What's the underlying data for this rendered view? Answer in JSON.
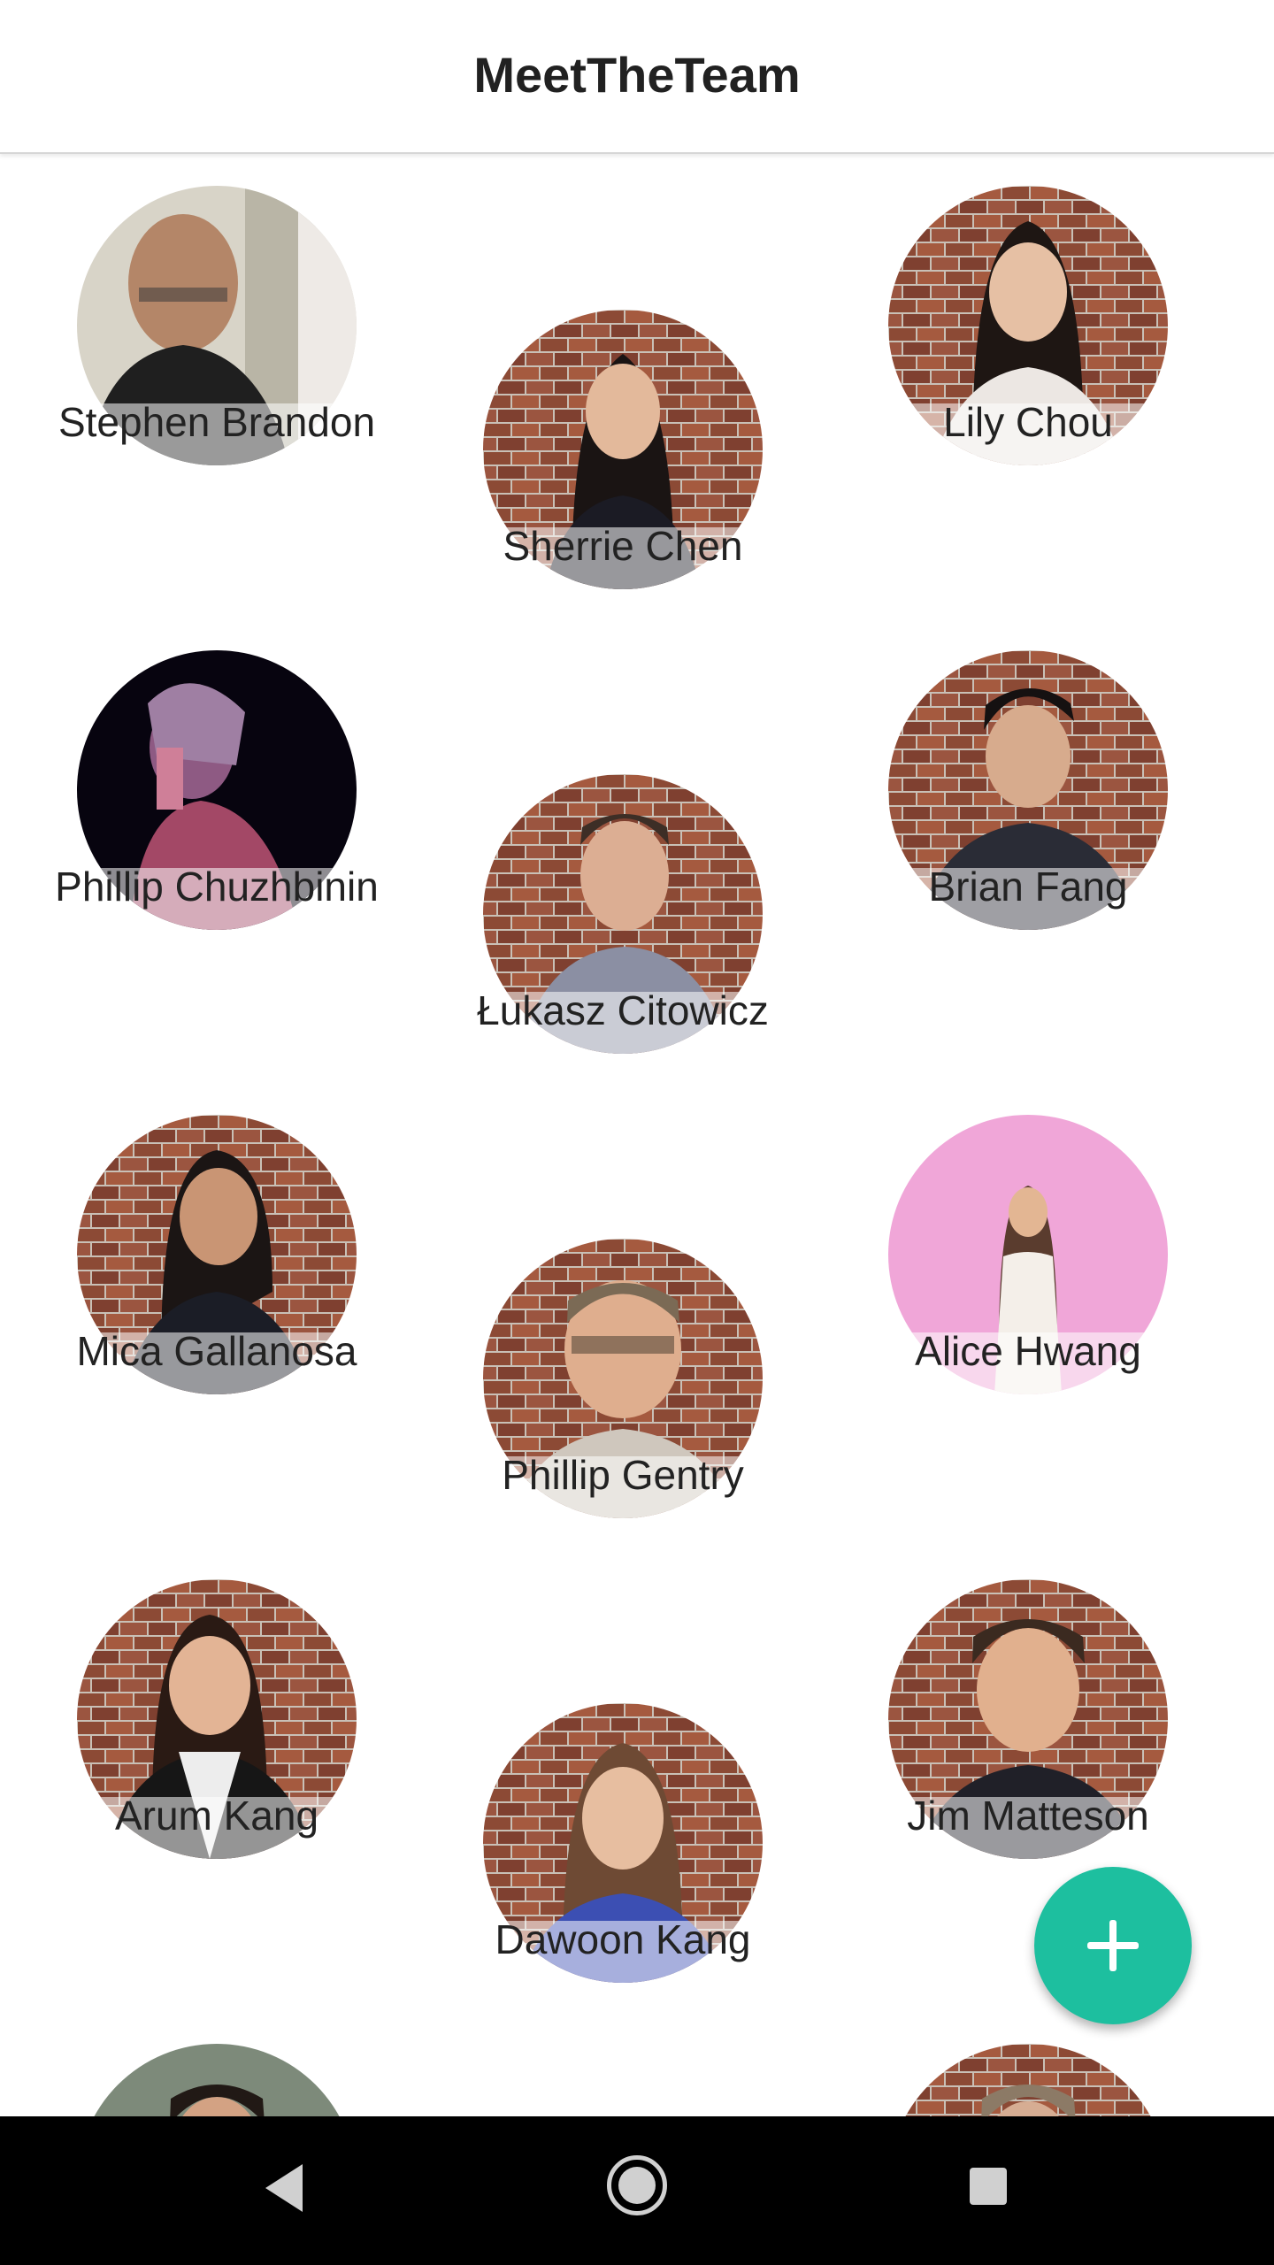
{
  "app": {
    "title": "MeetTheTeam"
  },
  "colors": {
    "accent": "#1dbf9f",
    "app_bar_background": "#ffffff",
    "nav_bar_background": "#000000"
  },
  "team": {
    "members": [
      {
        "name": "Stephen Brandon"
      },
      {
        "name": "Sherrie Chen"
      },
      {
        "name": "Lily Chou"
      },
      {
        "name": "Phillip Chuzhbinin"
      },
      {
        "name": "Łukasz Citowicz"
      },
      {
        "name": "Brian Fang"
      },
      {
        "name": "Mica Gallanosa"
      },
      {
        "name": "Phillip Gentry"
      },
      {
        "name": "Alice Hwang"
      },
      {
        "name": "Arum Kang"
      },
      {
        "name": "Dawoon Kang"
      },
      {
        "name": "Jim Matteson"
      }
    ]
  },
  "fab": {
    "icon": "plus-icon"
  },
  "system_nav": {
    "back_icon": "back-triangle-icon",
    "home_icon": "home-circle-icon",
    "recents_icon": "recents-square-icon"
  }
}
